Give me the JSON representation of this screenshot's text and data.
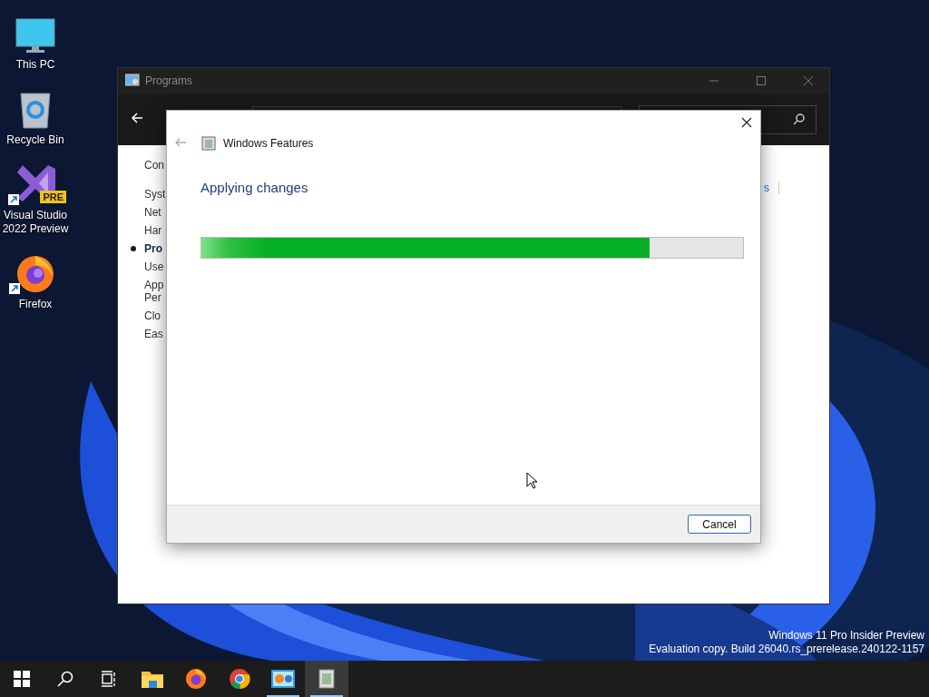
{
  "desktop_icons": [
    {
      "kind": "pc",
      "label": "This PC",
      "shortcut": false
    },
    {
      "kind": "bin",
      "label": "Recycle Bin",
      "shortcut": false
    },
    {
      "kind": "vs",
      "label": "Visual Studio 2022 Preview",
      "badge": "PRE",
      "shortcut": true
    },
    {
      "kind": "firefox",
      "label": "Firefox",
      "shortcut": true
    }
  ],
  "programs_window": {
    "title": "Programs",
    "sidebar": [
      {
        "label": "Con",
        "selected": false
      },
      {
        "label": "Syst",
        "selected": false
      },
      {
        "label": "Net",
        "selected": false
      },
      {
        "label": "Har",
        "selected": false
      },
      {
        "label": "Pro",
        "selected": true
      },
      {
        "label": "Use",
        "selected": false
      },
      {
        "label": "App\nPer",
        "selected": false
      },
      {
        "label": "Clo",
        "selected": false
      },
      {
        "label": "Eas",
        "selected": false
      }
    ],
    "link_fragment": "s"
  },
  "dialog": {
    "title": "Windows Features",
    "heading": "Applying changes",
    "progress": {
      "level": 0.828
    },
    "buttons": [
      "Cancel"
    ]
  },
  "watermark": [
    "Windows 11 Pro Insider Preview",
    "Evaluation copy. Build 26040.rs_prerelease.240122-1157"
  ],
  "taskbar": [
    {
      "kind": "start",
      "selected": false,
      "running": false
    },
    {
      "kind": "search",
      "selected": false,
      "running": false
    },
    {
      "kind": "taskview",
      "selected": false,
      "running": false
    },
    {
      "kind": "explorer",
      "selected": false,
      "running": false
    },
    {
      "kind": "firefox",
      "selected": false,
      "running": false
    },
    {
      "kind": "chrome",
      "selected": false,
      "running": false
    },
    {
      "kind": "controlpanel",
      "selected": false,
      "running": true
    },
    {
      "kind": "features",
      "selected": true,
      "running": true
    }
  ]
}
